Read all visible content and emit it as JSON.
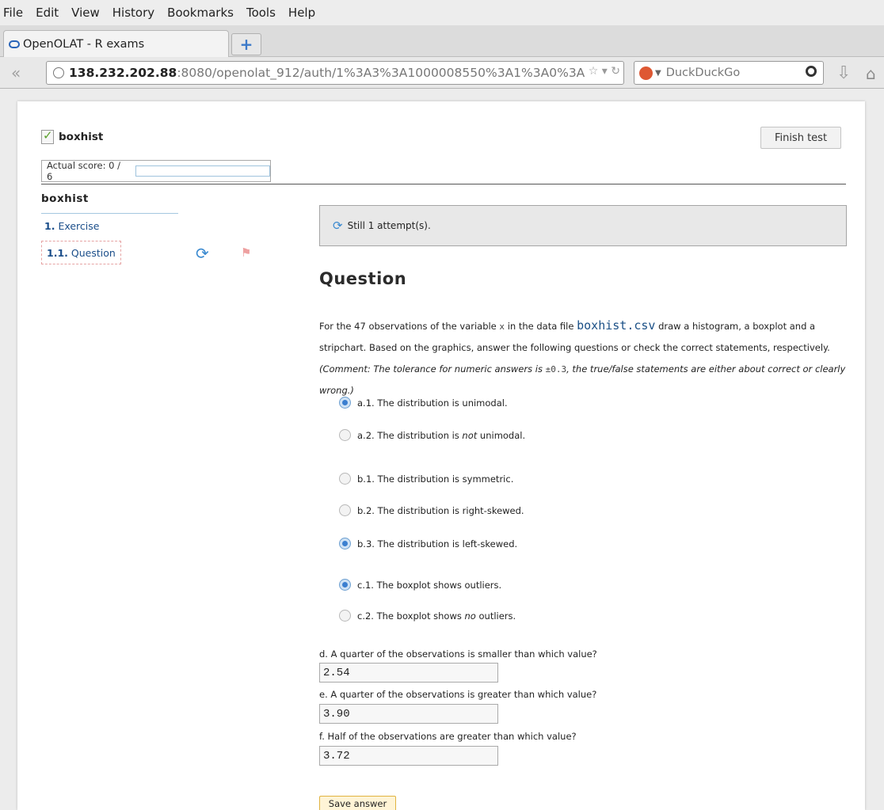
{
  "browser": {
    "menu": [
      {
        "label": "File"
      },
      {
        "label": "Edit"
      },
      {
        "label": "View"
      },
      {
        "label": "History"
      },
      {
        "label": "Bookmarks"
      },
      {
        "label": "Tools"
      },
      {
        "label": "Help"
      }
    ],
    "tab_title": "OpenOLAT - R exams",
    "url_host": "138.232.202.88",
    "url_rest": ":8080/openolat_912/auth/1%3A3%3A1000008550%3A1%3A0%3A",
    "search_placeholder": "DuckDuckGo",
    "icons": [
      "back-icon",
      "new-tab-icon",
      "site-identity-icon",
      "bookmark-star-icon",
      "reload-icon",
      "search-engine-icon",
      "search-icon",
      "download-icon",
      "home-icon"
    ]
  },
  "test": {
    "title": "boxhist",
    "finish_label": "Finish test",
    "score_label": "Actual score: 0 / 6",
    "score_fraction": 0
  },
  "sidebar": {
    "title": "boxhist",
    "exercise": {
      "num": "1.",
      "label": "Exercise"
    },
    "question": {
      "num": "1.1.",
      "label": "Question"
    }
  },
  "attempt_text": "Still 1 attempt(s).",
  "question": {
    "heading": "Question",
    "intro_1": "For the 47 observations of the variable",
    "variable": "x",
    "intro_2": "in the data file",
    "file": "boxhist.csv",
    "intro_3": "draw a histogram, a boxplot and a stripchart.",
    "intro_4": "Based on the graphics, answer the following questions or check the correct statements, respectively.",
    "comment_1": "(Comment: The tolerance for numeric answers is",
    "tolerance": "±0.3",
    "comment_2": ", the true/false statements are either about correct or clearly wrong.)",
    "options": [
      {
        "text": "a.1. The distribution is unimodal.",
        "selected": true
      },
      {
        "pre": "a.2. The distribution is ",
        "em": "not",
        "post": " unimodal.",
        "selected": false
      },
      {
        "text": "b.1. The distribution is symmetric.",
        "selected": false
      },
      {
        "text": "b.2. The distribution is right-skewed.",
        "selected": false
      },
      {
        "text": "b.3. The distribution is left-skewed.",
        "selected": true
      },
      {
        "text": "c.1. The boxplot shows outliers.",
        "selected": true
      },
      {
        "pre": "c.2. The boxplot shows ",
        "em": "no",
        "post": " outliers.",
        "selected": false
      }
    ],
    "numeric": [
      {
        "label": "d. A quarter of the observations is smaller than which value?",
        "value": "2.54"
      },
      {
        "label": "e. A quarter of the observations is greater than which value?",
        "value": "3.90"
      },
      {
        "label": "f. Half of the observations are greater than which value?",
        "value": "3.72"
      }
    ],
    "save_label": "Save answer"
  }
}
